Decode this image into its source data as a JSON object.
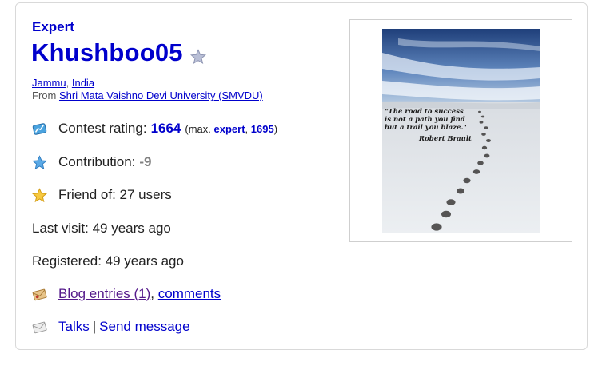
{
  "profile": {
    "rank": "Expert",
    "handle": "Khushboo05",
    "city": "Jammu",
    "country": "India",
    "from_prefix": "From",
    "organization": "Shri Mata Vaishno Devi University (SMVDU)"
  },
  "stats": {
    "rating_label": "Contest rating:",
    "rating_value": "1664",
    "max_open": "(max.",
    "max_rank": "expert",
    "max_comma": ",",
    "max_value": "1695",
    "max_close": ")",
    "contribution_label": "Contribution:",
    "contribution_value": "-9",
    "friend_label": "Friend of: 27 users",
    "last_visit": "Last visit: 49 years ago",
    "registered": "Registered: 49 years ago"
  },
  "links": {
    "blog_entries": "Blog entries (1)",
    "comma": ",",
    "comments": "comments",
    "talks": "Talks",
    "pipe": "|",
    "send_message": "Send message"
  },
  "photo": {
    "quote_line1": "\"The road to success",
    "quote_line2": "is not a path you find",
    "quote_line3": "but a trail you blaze.\"",
    "author": "Robert Brault"
  },
  "colors": {
    "expert_blue": "#0000cc",
    "visited_link": "#551a8b",
    "contribution_gray": "#808080"
  },
  "icons": [
    "star-badge-icon",
    "rating-chart-icon",
    "blue-star-icon",
    "gold-star-icon",
    "blog-envelope-icon",
    "talk-envelope-icon"
  ]
}
